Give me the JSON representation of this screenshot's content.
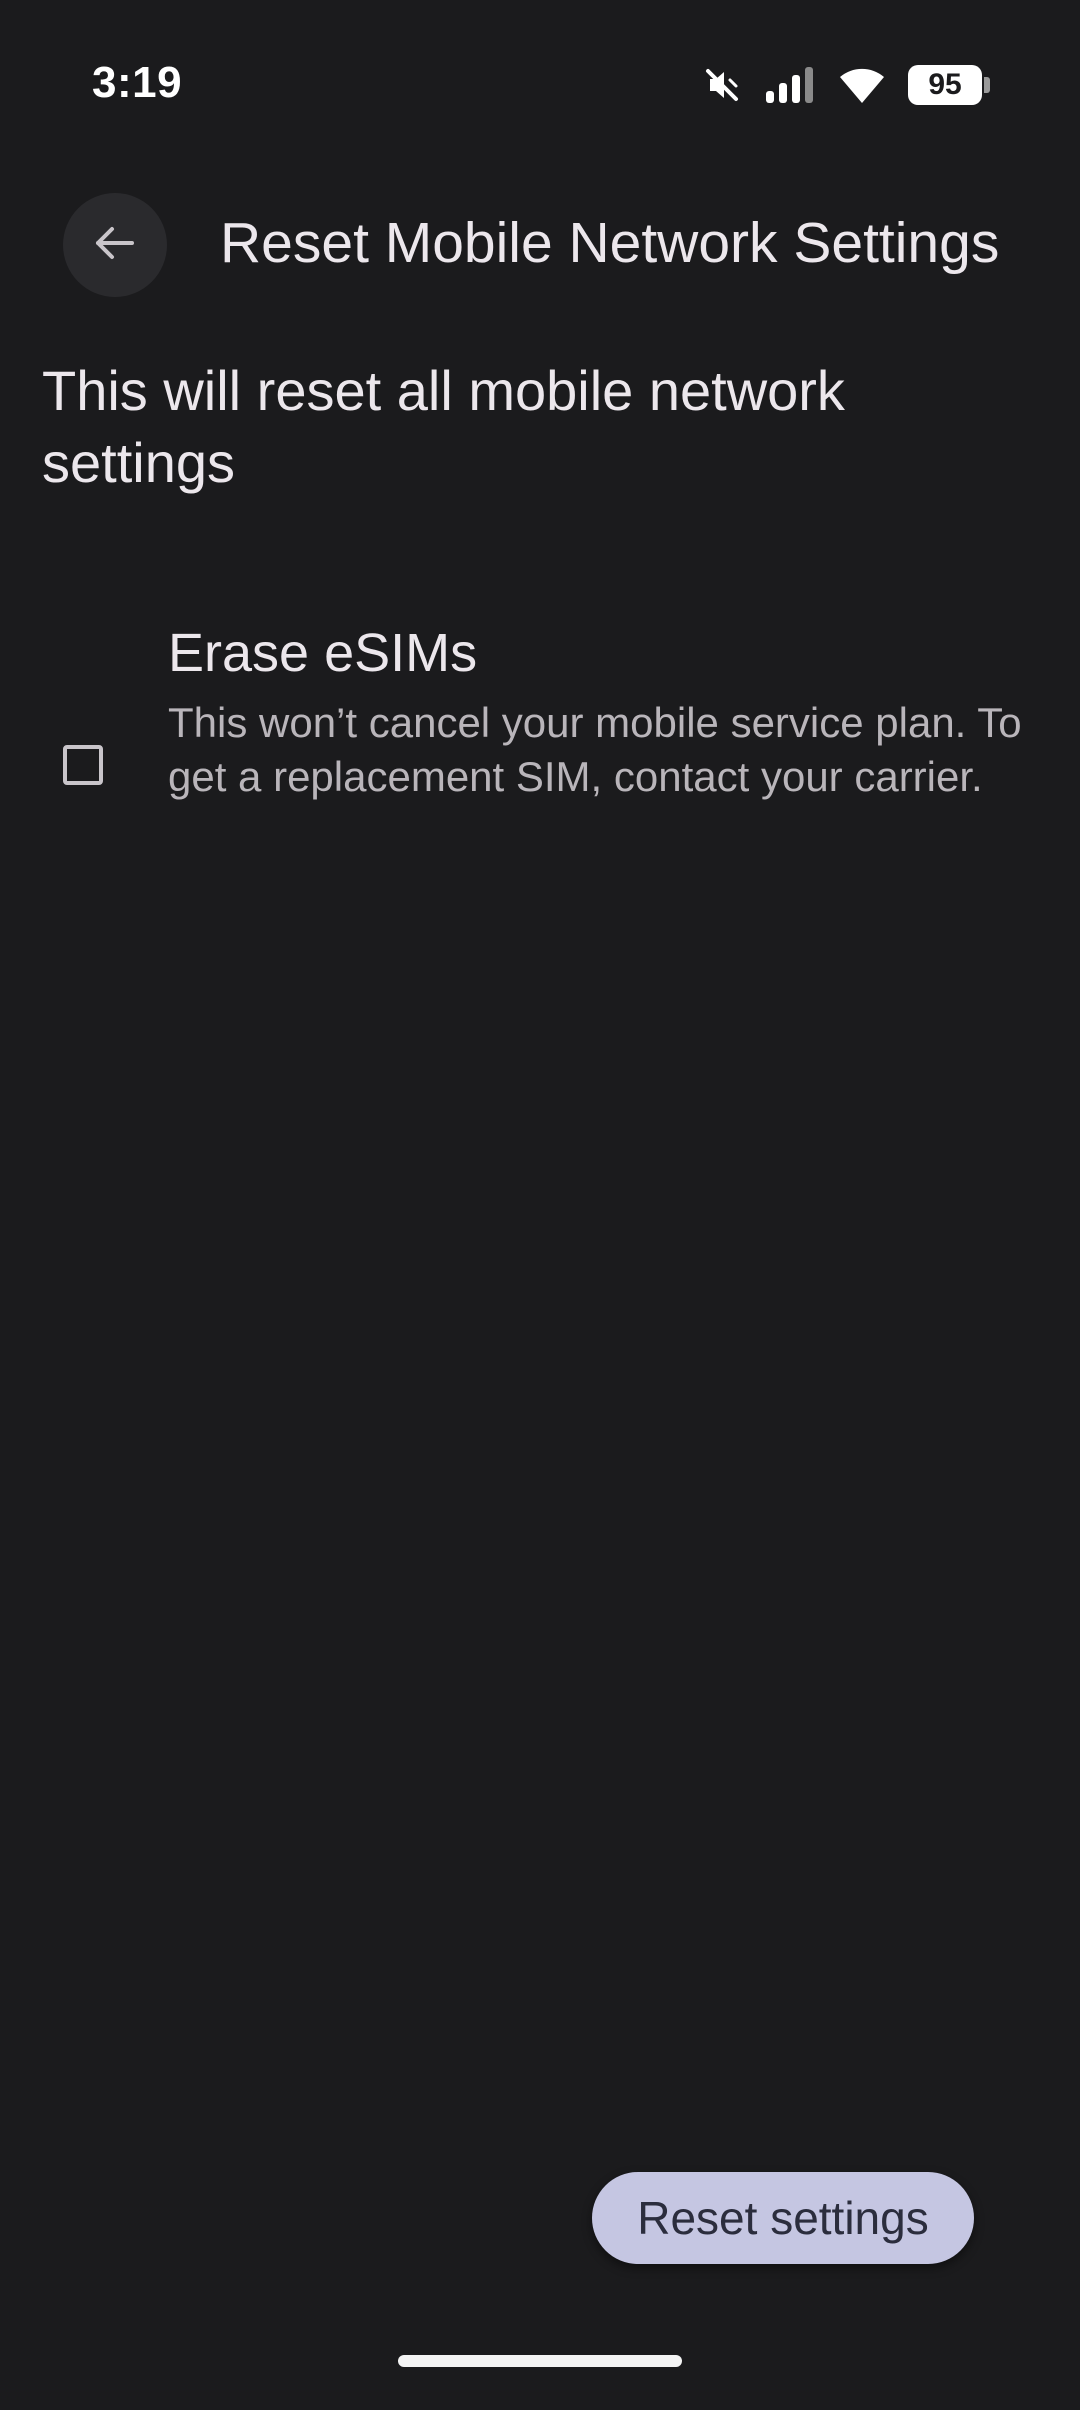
{
  "status_bar": {
    "time": "3:19",
    "battery_level": "95",
    "icons": [
      "mute-vibrate-icon",
      "signal-icon",
      "wifi-icon",
      "battery-icon"
    ]
  },
  "app_bar": {
    "title": "Reset Mobile Network Settings",
    "back_icon": "arrow-back-icon"
  },
  "main": {
    "description": "This will reset all mobile network settings",
    "option": {
      "title": "Erase eSIMs",
      "summary": "This won’t cancel your mobile service plan. To get a replacement SIM, contact your carrier.",
      "checked": false
    }
  },
  "actions": {
    "reset_label": "Reset settings"
  },
  "colors": {
    "background": "#1b1b1d",
    "button_background": "#c5c6e2",
    "button_text": "#2b2d3d",
    "text_primary": "#ece7ec",
    "text_secondary": "#b9b5ba"
  }
}
